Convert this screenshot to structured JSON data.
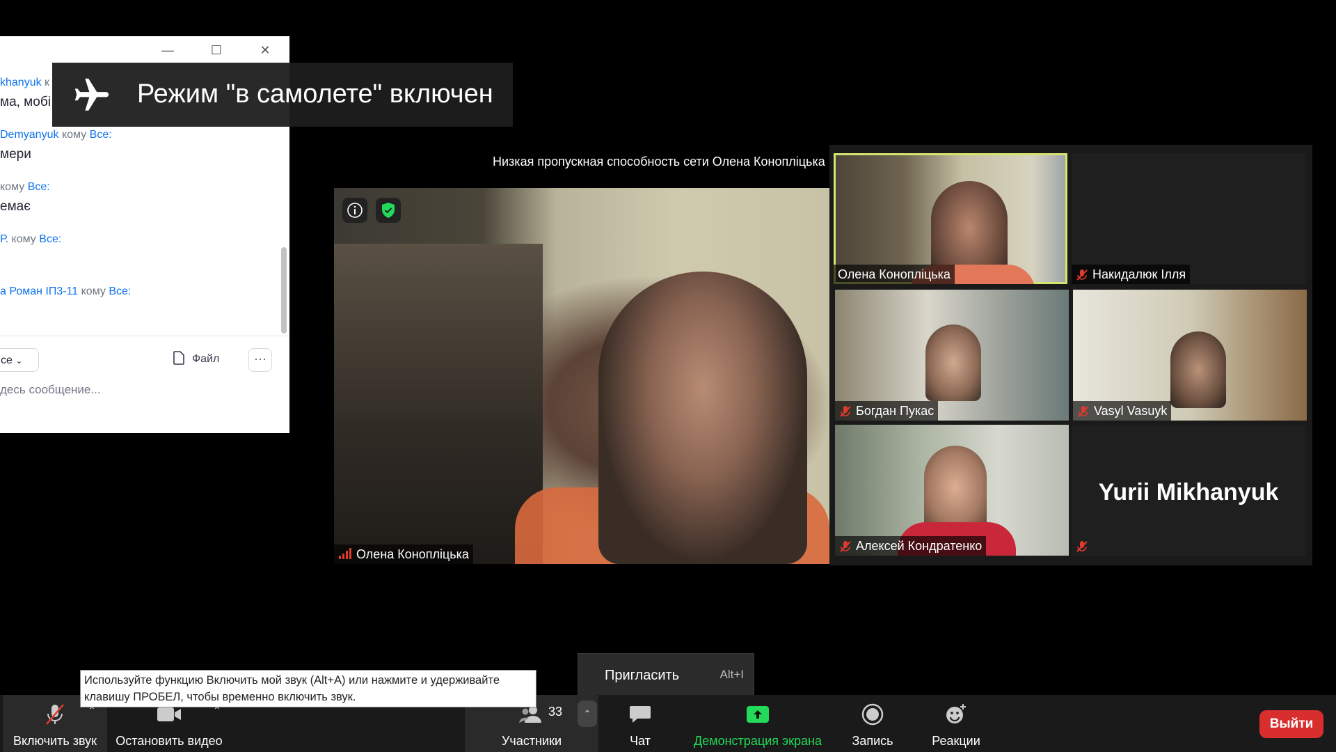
{
  "chat": {
    "messages": [
      {
        "sender": "khanyuk",
        "to_word": "к",
        "recipient": "",
        "text": "ма, мобі"
      },
      {
        "sender": "Demyanyuk",
        "to_word": "кому",
        "recipient": "Все:",
        "text": "мери"
      },
      {
        "sender": "",
        "to_word": "кому",
        "recipient": "Все:",
        "text": "емає"
      },
      {
        "sender": "Р.",
        "to_word": "кому",
        "recipient": "Все:",
        "text": ""
      },
      {
        "sender": "а Роман ІП3-11",
        "to_word": "кому",
        "recipient": "Все:",
        "text": ""
      }
    ],
    "recipient_select": "се",
    "file_label": "Файл",
    "more_label": "···",
    "input_placeholder": "десь сообщение..."
  },
  "toast": {
    "text": "Режим \"в самолете\" включен"
  },
  "low_bandwidth": "Низкая пропускная способность сети Олена Конопліцька",
  "main_video": {
    "name": "Олена Конопліцька"
  },
  "gallery": [
    {
      "name": "Олена Конопліцька",
      "active": true,
      "muted": false
    },
    {
      "name": "Накидалюк Ілля",
      "muted": true
    },
    {
      "name": "Богдан Пукас",
      "muted": true
    },
    {
      "name": "Vasyl Vasuyk",
      "muted": true
    },
    {
      "name": "Алексей Кондратенко",
      "muted": true
    },
    {
      "name": "Yurii Mikhanyuk",
      "muted": true,
      "video_off": true
    }
  ],
  "invite": {
    "label": "Пригласить",
    "shortcut": "Alt+I"
  },
  "tooltip": {
    "text": "Используйте функцию Включить мой звук (Alt+A) или нажмите и удерживайте клавишу ПРОБЕЛ, чтобы временно включить звук."
  },
  "toolbar": {
    "unmute": "Включить звук",
    "stop_video": "Остановить видео",
    "participants": "Участники",
    "participants_count": "33",
    "chat": "Чат",
    "share": "Демонстрация экрана",
    "record": "Запись",
    "reactions": "Реакции",
    "leave": "Выйти"
  },
  "colors": {
    "accent_blue": "#0e72ed",
    "share_green": "#23d959",
    "leave_red": "#d92e2e",
    "active_border": "#d7e36f",
    "muted_red": "#e0392e"
  }
}
